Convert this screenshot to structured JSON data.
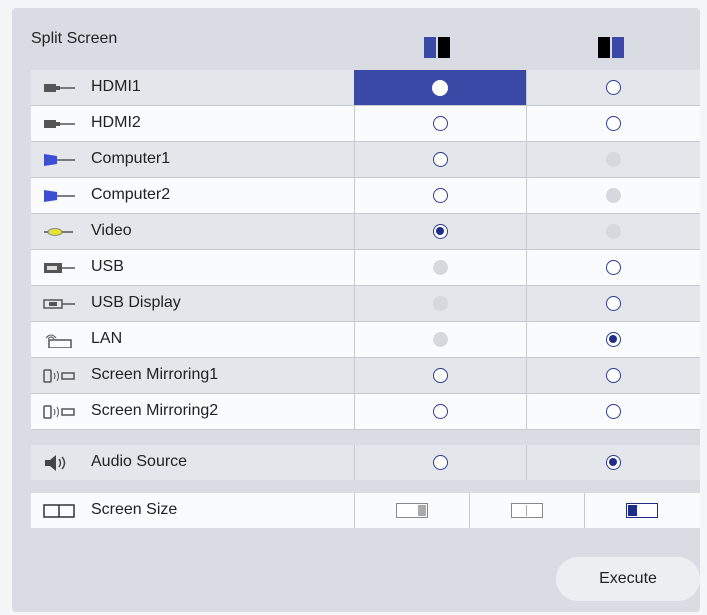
{
  "header": {
    "title": "Split Screen",
    "col1_icon": "split-left-active-icon",
    "col2_icon": "split-right-active-icon",
    "accent": "#3a49a6"
  },
  "sources": [
    {
      "label": "HDMI1",
      "icon": "hdmi-icon",
      "left": "selected-highlight",
      "right": "off"
    },
    {
      "label": "HDMI2",
      "icon": "hdmi-icon",
      "left": "off",
      "right": "off"
    },
    {
      "label": "Computer1",
      "icon": "vga-icon",
      "left": "off",
      "right": "disabled"
    },
    {
      "label": "Computer2",
      "icon": "vga-icon",
      "left": "off",
      "right": "disabled"
    },
    {
      "label": "Video",
      "icon": "video-icon",
      "left": "checked",
      "right": "disabled"
    },
    {
      "label": "USB",
      "icon": "usb-icon",
      "left": "disabled",
      "right": "off"
    },
    {
      "label": "USB Display",
      "icon": "usb-display-icon",
      "left": "disabled",
      "right": "off"
    },
    {
      "label": "LAN",
      "icon": "lan-icon",
      "left": "disabled",
      "right": "checked"
    },
    {
      "label": "Screen Mirroring1",
      "icon": "mirroring-icon",
      "left": "off",
      "right": "off"
    },
    {
      "label": "Screen Mirroring2",
      "icon": "mirroring-icon",
      "left": "off",
      "right": "off"
    }
  ],
  "audio": {
    "label": "Audio Source",
    "icon": "speaker-icon",
    "left": "off",
    "right": "checked"
  },
  "screen_size": {
    "label": "Screen Size",
    "icon": "screen-size-icon",
    "options": [
      "left-large",
      "equal",
      "right-large"
    ],
    "selected": 2
  },
  "execute_label": "Execute"
}
